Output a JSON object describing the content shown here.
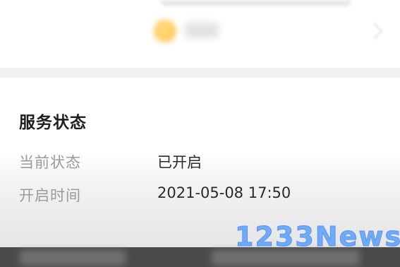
{
  "service_status": {
    "title": "服务状态",
    "rows": [
      {
        "label": "当前状态",
        "value": "已开启"
      },
      {
        "label": "开启时间",
        "value": "2021-05-08 17:50"
      }
    ]
  },
  "watermark": "1233News",
  "colors": {
    "accent_coin": "#ffb42a",
    "watermark": "#5aa0ff",
    "background": "#ffffff",
    "divider": "#f1f1f1"
  },
  "icons": [
    "coin-icon",
    "chevron-right-icon"
  ]
}
